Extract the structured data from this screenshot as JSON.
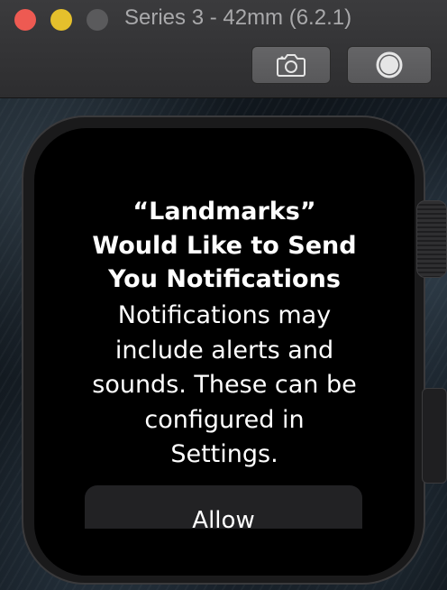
{
  "window": {
    "title": "Series 3 - 42mm (6.2.1)"
  },
  "toolbar": {
    "screenshot_icon": "camera-icon",
    "home_icon": "home-button-icon"
  },
  "alert": {
    "title": "“Landmarks” Would Like to Send You Notifications",
    "message": "Notifications may include alerts and sounds. These can be configured in Settings.",
    "allow_label": "Allow"
  },
  "colors": {
    "close": "#ee5a52",
    "minimize": "#e5c02c",
    "zoom_disabled": "#5a5a5c"
  }
}
